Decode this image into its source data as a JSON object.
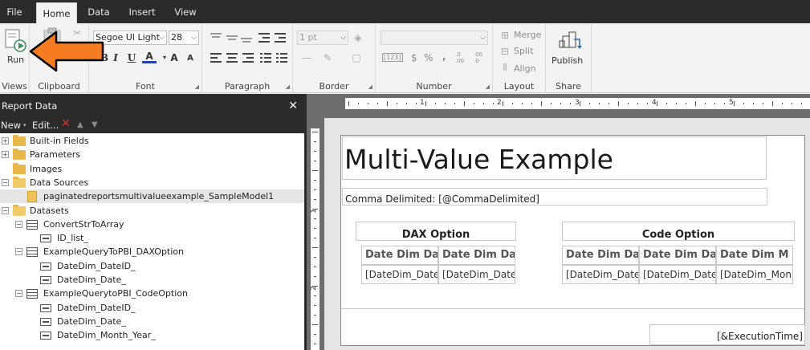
{
  "menu": {
    "tabs": [
      {
        "label": "File"
      },
      {
        "label": "Home"
      },
      {
        "label": "Data"
      },
      {
        "label": "Insert"
      },
      {
        "label": "View"
      }
    ]
  },
  "ribbon": {
    "views": {
      "run_label": "Run",
      "group_label": "Views"
    },
    "clipboard": {
      "group_label": "Clipboard"
    },
    "font": {
      "family": "Segoe UI Light",
      "size": "28",
      "group_label": "Font",
      "bold": "B",
      "italic": "I",
      "underline": "U",
      "font_color": "A",
      "grow": "A",
      "shrink": "A"
    },
    "paragraph": {
      "group_label": "Paragraph"
    },
    "border": {
      "width": "1 pt",
      "group_label": "Border"
    },
    "number": {
      "format": "",
      "group_label": "Number",
      "currency": "$",
      "percent": "%",
      "comma": ",",
      "placeholder": "[123]",
      "inc_decimal": ".0 .00",
      "dec_decimal": ".00 .0"
    },
    "layout": {
      "merge": "Merge",
      "split": "Split",
      "align": "Align",
      "group_label": "Layout"
    },
    "share": {
      "publish": "Publish",
      "group_label": "Share"
    }
  },
  "report_data_panel": {
    "title": "Report Data",
    "toolbar": {
      "new_label": "New",
      "edit_label": "Edit..."
    },
    "tree": [
      {
        "label": "Built-in Fields",
        "level": 0,
        "expander": "+",
        "icon": "folder-icon"
      },
      {
        "label": "Parameters",
        "level": 0,
        "expander": "+",
        "icon": "folder-icon"
      },
      {
        "label": "Images",
        "level": 0,
        "expander": "",
        "icon": "folder-icon"
      },
      {
        "label": "Data Sources",
        "level": 0,
        "expander": "−",
        "icon": "folder-open-icon"
      },
      {
        "label": "paginatedreportsmultivalueexample_SampleModel1",
        "level": 1,
        "expander": "",
        "icon": "datasource-icon",
        "selected": true
      },
      {
        "label": "Datasets",
        "level": 0,
        "expander": "−",
        "icon": "folder-open-icon"
      },
      {
        "label": "ConvertStrToArray",
        "level": 1,
        "expander": "−",
        "icon": "table-icon"
      },
      {
        "label": "ID_list_",
        "level": 2,
        "expander": "",
        "icon": "field-icon"
      },
      {
        "label": "ExampleQueryToPBI_DAXOption",
        "level": 1,
        "expander": "−",
        "icon": "table-icon"
      },
      {
        "label": "DateDim_DateID_",
        "level": 2,
        "expander": "",
        "icon": "field-icon"
      },
      {
        "label": "DateDim_Date_",
        "level": 2,
        "expander": "",
        "icon": "field-icon"
      },
      {
        "label": "ExampleQuerytoPBI_CodeOption",
        "level": 1,
        "expander": "−",
        "icon": "table-icon"
      },
      {
        "label": "DateDim_DateID_",
        "level": 2,
        "expander": "",
        "icon": "field-icon"
      },
      {
        "label": "DateDim_Date_",
        "level": 2,
        "expander": "",
        "icon": "field-icon"
      },
      {
        "label": "DateDim_Month_Year_",
        "level": 2,
        "expander": "",
        "icon": "field-icon"
      }
    ]
  },
  "ruler": {
    "top_numbers": [
      "1",
      "2",
      "3",
      "4",
      "5"
    ],
    "left_numbers": [
      "1",
      "2"
    ]
  },
  "report": {
    "title": "Multi-Value Example",
    "comma_delimited": "Comma Delimited: [@CommaDelimited]",
    "dax_table": {
      "title": "DAX Option",
      "headers": [
        "Date Dim Da",
        "Date Dim Da"
      ],
      "cells": [
        "[DateDim_Date",
        "[DateDim_Date_"
      ]
    },
    "code_table": {
      "title": "Code Option",
      "headers": [
        "Date Dim Da",
        "Date Dim Da",
        "Date Dim M"
      ],
      "cells": [
        "[DateDim_Date",
        "[DateDim_Date_",
        "[DateDim_Mon"
      ]
    },
    "execution_time": "[&ExecutionTime]"
  },
  "colors": {
    "menu_bar": "#2b2b2b",
    "ribbon_bg": "#f3f3f3",
    "canvas_bg": "#6d6d6d",
    "callout_arrow": "#f57c20",
    "folder": "#e8b84a",
    "delete_icon": "#d9362b"
  }
}
